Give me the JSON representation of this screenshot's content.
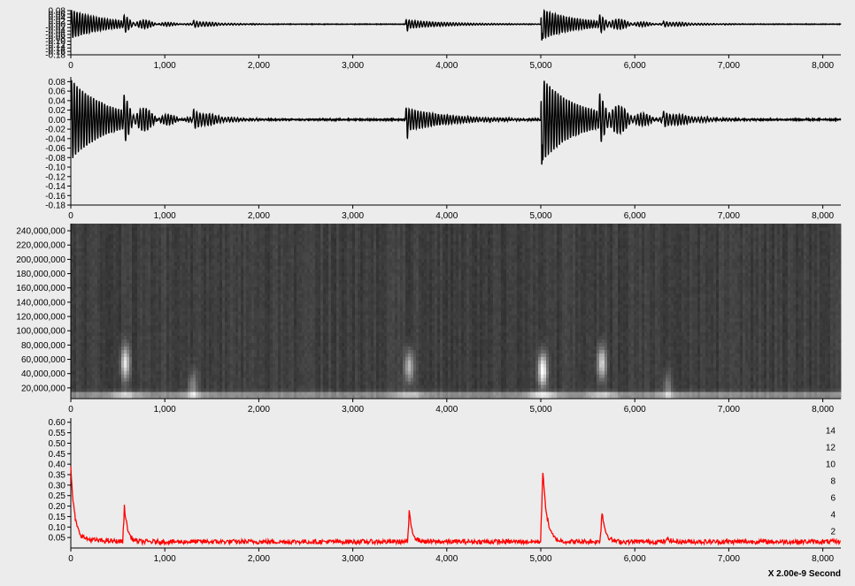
{
  "x_unit_label": "X 2.00e-9 Second",
  "colors": {
    "background": "#ececec",
    "signal": "#000000",
    "energy": "#ff0000",
    "axis": "#000000"
  },
  "chart_data": [
    {
      "type": "line",
      "panel": "waveform-overview",
      "xlim": [
        0,
        8192
      ],
      "ylim": [
        -0.18,
        0.08
      ],
      "x_ticks": [
        0,
        1000,
        2000,
        3000,
        4000,
        5000,
        6000,
        7000,
        8000
      ],
      "x_tick_labels": [
        "0",
        "1,000",
        "2,000",
        "3,000",
        "4,000",
        "5,000",
        "6,000",
        "7,000",
        "8,000"
      ],
      "y_ticks": [
        0.08,
        0.06,
        0.04,
        0.02,
        0.0,
        -0.02,
        -0.04,
        -0.06,
        -0.08,
        -0.1,
        -0.12,
        -0.14,
        -0.16,
        -0.18
      ],
      "y_tick_labels": [
        "0.08",
        "0.06",
        "0.04",
        "0.02",
        "0.00",
        "-0.02",
        "-0.04",
        "-0.06",
        "-0.08",
        "-0.10",
        "-0.12",
        "-0.14",
        "-0.16",
        "-0.18"
      ],
      "events": [
        {
          "start": 0,
          "amp": 0.085,
          "freq": 0.034,
          "decay": 380
        },
        {
          "start": 560,
          "amp": 0.035,
          "freq": 0.03,
          "decay": 250
        },
        {
          "start": 1300,
          "amp": 0.02,
          "freq": 0.03,
          "decay": 250
        },
        {
          "start": 3560,
          "amp": 0.025,
          "freq": 0.032,
          "decay": 450
        },
        {
          "start": 5000,
          "amp": 0.09,
          "freq": 0.034,
          "decay": 380
        },
        {
          "start": 5620,
          "amp": 0.04,
          "freq": 0.03,
          "decay": 300
        },
        {
          "start": 6300,
          "amp": 0.02,
          "freq": 0.03,
          "decay": 300
        }
      ],
      "spikes": [
        {
          "x": 5010,
          "y": -0.17
        },
        {
          "x": 3580,
          "y": -0.02
        }
      ]
    },
    {
      "type": "line",
      "panel": "waveform-detail",
      "xlim": [
        0,
        8192
      ],
      "ylim": [
        -0.18,
        0.09
      ],
      "x_ticks": [
        0,
        1000,
        2000,
        3000,
        4000,
        5000,
        6000,
        7000,
        8000
      ],
      "x_tick_labels": [
        "0",
        "1,000",
        "2,000",
        "3,000",
        "4,000",
        "5,000",
        "6,000",
        "7,000",
        "8,000"
      ],
      "y_ticks": [
        0.08,
        0.06,
        0.04,
        0.02,
        0.0,
        -0.02,
        -0.04,
        -0.06,
        -0.08,
        -0.1,
        -0.12,
        -0.14,
        -0.16,
        -0.18
      ],
      "y_tick_labels": [
        "0.08",
        "0.06",
        "0.04",
        "0.02",
        "0.00",
        "-0.02",
        "-0.04",
        "-0.06",
        "-0.08",
        "-0.10",
        "-0.12",
        "-0.14",
        "-0.16",
        "-0.18"
      ],
      "events": [
        {
          "start": 0,
          "amp": 0.085,
          "freq": 0.034,
          "decay": 380
        },
        {
          "start": 560,
          "amp": 0.035,
          "freq": 0.03,
          "decay": 250
        },
        {
          "start": 1300,
          "amp": 0.02,
          "freq": 0.03,
          "decay": 250
        },
        {
          "start": 3560,
          "amp": 0.025,
          "freq": 0.032,
          "decay": 450
        },
        {
          "start": 5000,
          "amp": 0.09,
          "freq": 0.034,
          "decay": 380
        },
        {
          "start": 5620,
          "amp": 0.04,
          "freq": 0.03,
          "decay": 300
        },
        {
          "start": 6300,
          "amp": 0.02,
          "freq": 0.03,
          "decay": 300
        }
      ],
      "spikes": [
        {
          "x": 5010,
          "y": -0.17
        },
        {
          "x": 3580,
          "y": -0.02
        }
      ]
    },
    {
      "type": "heatmap",
      "panel": "spectrogram",
      "xlim": [
        0,
        8192
      ],
      "ylim": [
        5000000,
        250000000
      ],
      "x_ticks": [
        0,
        1000,
        2000,
        3000,
        4000,
        5000,
        6000,
        7000,
        8000
      ],
      "x_tick_labels": [
        "0",
        "1,000",
        "2,000",
        "3,000",
        "4,000",
        "5,000",
        "6,000",
        "7,000",
        "8,000"
      ],
      "y_ticks": [
        240000000,
        220000000,
        200000000,
        180000000,
        160000000,
        140000000,
        120000000,
        100000000,
        80000000,
        60000000,
        40000000,
        20000000
      ],
      "y_tick_labels": [
        "240,000,000",
        "220,000,000",
        "200,000,000",
        "180,000,000",
        "160,000,000",
        "140,000,000",
        "120,000,000",
        "100,000,000",
        "80,000,000",
        "60,000,000",
        "40,000,000",
        "20,000,000"
      ],
      "base_band": {
        "freq": 10000000,
        "intensity": 0.85
      },
      "hotspots": [
        {
          "x": 580,
          "freq": 55000000,
          "intensity": 0.75
        },
        {
          "x": 1300,
          "freq": 20000000,
          "intensity": 0.35
        },
        {
          "x": 3600,
          "freq": 50000000,
          "intensity": 0.6
        },
        {
          "x": 5020,
          "freq": 45000000,
          "intensity": 0.95
        },
        {
          "x": 5650,
          "freq": 55000000,
          "intensity": 0.7
        },
        {
          "x": 6350,
          "freq": 20000000,
          "intensity": 0.3
        }
      ]
    },
    {
      "type": "line",
      "panel": "energy",
      "xlim": [
        0,
        8192
      ],
      "ylim": [
        0.0,
        0.62
      ],
      "y2lim": [
        0,
        15.5
      ],
      "x_ticks": [
        0,
        1000,
        2000,
        3000,
        4000,
        5000,
        6000,
        7000,
        8000
      ],
      "x_tick_labels": [
        "0",
        "1,000",
        "2,000",
        "3,000",
        "4,000",
        "5,000",
        "6,000",
        "7,000",
        "8,000"
      ],
      "y_ticks": [
        0.6,
        0.55,
        0.5,
        0.45,
        0.4,
        0.35,
        0.3,
        0.25,
        0.2,
        0.15,
        0.1,
        0.05
      ],
      "y_tick_labels": [
        "0.60",
        "0.55",
        "0.50",
        "0.45",
        "0.40",
        "0.35",
        "0.30",
        "0.25",
        "0.20",
        "0.15",
        "0.10",
        "0.05"
      ],
      "y2_ticks": [
        14,
        12,
        10,
        8,
        6,
        4,
        2
      ],
      "y2_tick_labels": [
        "14",
        "12",
        "10",
        "8",
        "6",
        "4",
        "2"
      ],
      "baseline": 0.03,
      "peaks": [
        {
          "x": 0,
          "y": 0.36,
          "width": 60
        },
        {
          "x": 570,
          "y": 0.2,
          "width": 55
        },
        {
          "x": 3600,
          "y": 0.17,
          "width": 55
        },
        {
          "x": 5020,
          "y": 0.38,
          "width": 70
        },
        {
          "x": 5650,
          "y": 0.18,
          "width": 60
        },
        {
          "x": 6350,
          "y": 0.05,
          "width": 40
        }
      ]
    }
  ]
}
